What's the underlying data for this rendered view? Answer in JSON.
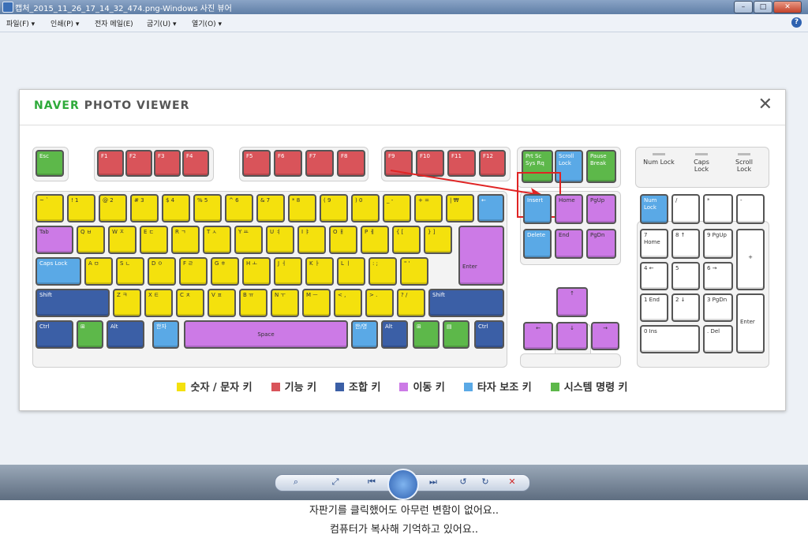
{
  "window": {
    "title": "캡처_2015_11_26_17_14_32_474.png-Windows 사진 뷰어",
    "min": "–",
    "max": "□",
    "close": "✕"
  },
  "menu": {
    "items": [
      "파일(F) ▾",
      "인쇄(P) ▾",
      "전자 메일(E)",
      "굽기(U) ▾",
      "열기(O) ▾"
    ],
    "help": "?"
  },
  "viewer": {
    "brand_naver": "NAVER",
    "brand_rest": "PHOTO VIEWER",
    "close": "✕"
  },
  "keys": {
    "esc": "Esc",
    "f": [
      "F1",
      "F2",
      "F3",
      "F4",
      "F5",
      "F6",
      "F7",
      "F8",
      "F9",
      "F10",
      "F11",
      "F12"
    ],
    "prtsc": "Prt Sc",
    "sysrq": "Sys Rq",
    "scroll": "Scroll Lock",
    "pause": "Pause Break",
    "num_row": [
      "~ `",
      "! 1",
      "@ 2",
      "# 3",
      "$ 4",
      "% 5",
      "^ 6",
      "& 7",
      "* 8",
      "( 9",
      ") 0",
      "_ -",
      "+ =",
      "| ₩"
    ],
    "backspace": "←",
    "tab": "Tab",
    "q_row": [
      "Q ㅂ",
      "W ㅈ",
      "E ㄷ",
      "R ㄱ",
      "T ㅅ",
      "Y ㅛ",
      "U ㅕ",
      "I ㅑ",
      "O ㅐ",
      "P ㅔ",
      "{ [",
      "} ]"
    ],
    "caps": "Caps Lock",
    "a_row": [
      "A ㅁ",
      "S ㄴ",
      "D ㅇ",
      "F ㄹ",
      "G ㅎ",
      "H ㅗ",
      "J ㅓ",
      "K ㅏ",
      "L ㅣ",
      ": ;",
      "\" '"
    ],
    "enter": "Enter",
    "shift": "Shift",
    "z_row": [
      "Z ㅋ",
      "X ㅌ",
      "C ㅊ",
      "V ㅍ",
      "B ㅠ",
      "N ㅜ",
      "M ㅡ",
      "< ,",
      "> .",
      "? /"
    ],
    "ctrl": "Ctrl",
    "alt": "Alt",
    "hanja": "한자",
    "space": "Space",
    "hanyoung": "한/영",
    "insert": "Insert",
    "home": "Home",
    "pgup": "PgUp",
    "delete": "Delete",
    "end": "End",
    "pgdn": "PgDn",
    "up": "↑",
    "left": "←",
    "down": "↓",
    "right": "→",
    "lock_labels": [
      "Num Lock",
      "Caps Lock",
      "Scroll Lock"
    ],
    "numpad": {
      "numlock": "Num Lock",
      "slash": "/",
      "star": "*",
      "minus": "-",
      "n7": "7 Home",
      "n8": "8 ↑",
      "n9": "9 PgUp",
      "plus": "+",
      "n4": "4 ←",
      "n5": "5",
      "n6": "6 →",
      "n1": "1 End",
      "n2": "2 ↓",
      "n3": "3 PgDn",
      "enter": "Enter",
      "n0": "0 Ins",
      "dot": ". Del"
    }
  },
  "legend": [
    {
      "label": "숫자 / 문자 키",
      "color": "#f4e10d"
    },
    {
      "label": "기능 키",
      "color": "#d9545a"
    },
    {
      "label": "조합 키",
      "color": "#3b5fa6"
    },
    {
      "label": "이동 키",
      "color": "#cc7ae6"
    },
    {
      "label": "타자 보조 키",
      "color": "#5aa9e6"
    },
    {
      "label": "시스템 명령 키",
      "color": "#5db84a"
    }
  ],
  "captions": {
    "line1": "자판기를 클릭했어도 아무런 변함이 없어요..",
    "line2": "컴퓨터가 복사해 기억하고 있어요.."
  }
}
